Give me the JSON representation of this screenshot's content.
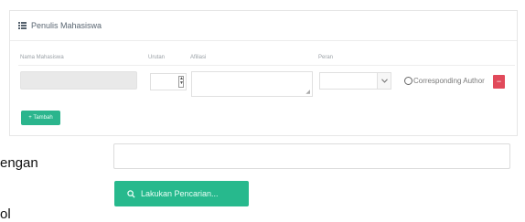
{
  "panel": {
    "title": "Penulis Mahasiswa",
    "columns": {
      "name": "Nama Mahasiswa",
      "order": "Urutan",
      "affiliation": "Afiliasi",
      "role": "Peran"
    },
    "row": {
      "corresponding_label": "Corresponding Author",
      "remove_label": "−"
    },
    "add_button_label": "+ Tambah"
  },
  "background": {
    "line1": "engan",
    "line2": "ol",
    "search_button_label": "Lakukan Pencarian..."
  },
  "colors": {
    "primary_green": "#27b98d",
    "danger_red": "#e14a5b"
  },
  "icons": {
    "header": "list-icon",
    "search": "magnifier-icon",
    "select": "chevron-down-icon"
  }
}
